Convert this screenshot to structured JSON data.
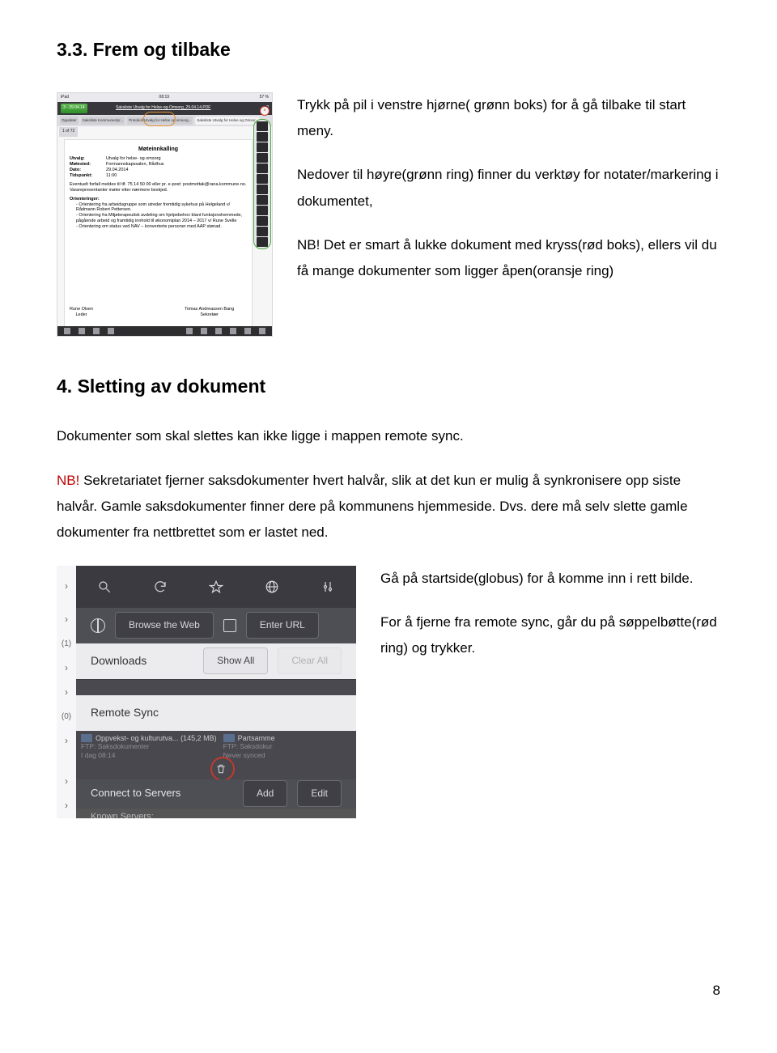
{
  "section33": {
    "heading": "3.3. Frem og tilbake",
    "para1": "Trykk på pil i venstre hjørne( grønn boks) for å gå tilbake til start meny.",
    "para2": "Nedover til høyre(grønn ring) finner du verktøy for notater/markering i dokumentet,",
    "para3": "NB! Det er smart å lukke dokument med kryss(rød boks), ellers vil du få mange dokumenter som ligger åpen(oransje ring)"
  },
  "screenshot1": {
    "status": {
      "left": "iPad",
      "center": "08:19",
      "right": "57 %"
    },
    "back_chip": "3 - 29.04.14",
    "pdf_title": "Saksliste Utvalg for Helse-og-Omsorg_29.04.14.PDF",
    "tabs": [
      "Oppdater",
      "Saksliste Kommunestyr...",
      "Protokoll Utvalg for Helse og omsorg...",
      "Saksliste Utvalg for Helse og Omsor..."
    ],
    "pages_chip": "1 of 72",
    "doc_heading": "Møteinnkalling",
    "meta": {
      "Utvalg": "Utvalg for helse- og omsorg",
      "Møtested": "Formannskapssalen, Rådhus",
      "Dato": "29.04.2014",
      "Tidspunkt": "11:00"
    },
    "note_line": "Eventuelt forfall meldes til tlf. 75 14 50 00 eller pr. e-post: postmottak@rana.kommune.no.",
    "note_line2": "Vararepresentanter møter etter nærmere beskjed.",
    "orient_label": "Orienteringer:",
    "orient_items": [
      "Orientering fra arbeidsgruppe som utreder fremtidig sykehus på Helgeland v/ Rådmann Robert Pettersen.",
      "Orientering fra Miljøterapeutisk avdeling om hjelpebehov blant funksjonshemmede, pågående arbeid og framtidig innhold til økonomiplan 2014 – 2017 v/ Rune Svelle",
      "Orientering om status ved NAV – konverterte personer med AAP stønad."
    ],
    "signers": {
      "left": "Rune Olsen",
      "left2": "Leder",
      "right": "Tomas Andreassen Bang",
      "right2": "Sekretær"
    }
  },
  "section4": {
    "heading": "4. Sletting av dokument",
    "para1": "Dokumenter som skal slettes kan ikke ligge i mappen remote sync.",
    "nb_label": "NB!",
    "para2a": " Sekretariatet fjerner saksdokumenter hvert halvår, slik at det kun er mulig å synkronisere opp siste halvår. Gamle saksdokumenter finner dere på kommunens hjemmeside. Dvs. dere må selv slette gamle dokumenter fra nettbrettet som er lastet ned.",
    "instr1": "Gå på startside(globus) for å komme inn i rett bilde.",
    "instr2": "For å fjerne fra remote sync, går du på søppelbøtte(rød ring) og trykker."
  },
  "screenshot3": {
    "row_browse": "Browse the Web",
    "row_url": "Enter URL",
    "row_downloads": "Downloads",
    "row_showall": "Show All",
    "row_clear": "Clear All",
    "row_remote": "Remote Sync",
    "left_counts": [
      "(1)",
      "(0)"
    ],
    "folders": [
      {
        "name": "Oppvekst- og kulturutva...",
        "size": "(145,2 MB)",
        "sub1": "FTP: Saksdokumenter",
        "sub2": "I dag 08:14"
      },
      {
        "name": "Partsamme",
        "sub1": "FTP: Saksdokur",
        "sub2": "Never synced"
      }
    ],
    "row_connect": "Connect to Servers",
    "btn_add": "Add",
    "btn_edit": "Edit",
    "row_known": "Known Servers:"
  },
  "page_number": "8"
}
